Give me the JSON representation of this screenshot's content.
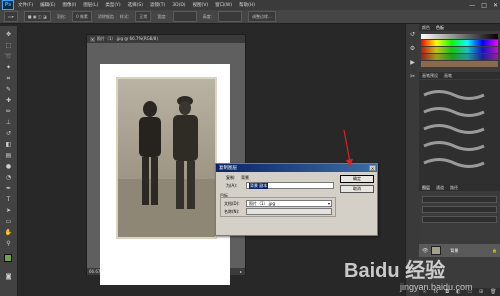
{
  "app": {
    "logo": "Ps",
    "accent": "#31a8ff"
  },
  "menu": [
    "文件(F)",
    "编辑(E)",
    "图像(I)",
    "图层(L)",
    "类型(Y)",
    "选择(S)",
    "滤镜(T)",
    "3D(D)",
    "视图(V)",
    "窗口(W)",
    "帮助(H)"
  ],
  "window_controls": [
    "—",
    "□",
    "✕"
  ],
  "options": {
    "feather_label": "羽化:",
    "feather_value": "0 像素",
    "antialias": "消除锯齿",
    "style_label": "样式:",
    "style_value": "正常",
    "width_label": "宽度:",
    "height_label": "高度:",
    "refine_edge": "调整边缘..."
  },
  "document": {
    "tab_title": "照片（1）.jpg @ 66.7%(RGB/8)",
    "zoom": "66.67%",
    "doc_size": "文档:1.32M/1.32M"
  },
  "dialog": {
    "title": "复制图层",
    "copy_label": "复制:",
    "copy_value": "背景",
    "as_label": "为(A):",
    "as_value": "背景 副本",
    "target_label": "目标",
    "doc_label": "文档(D):",
    "doc_value": "照片（1）.jpg",
    "name_label": "名称(N):",
    "name_value": "",
    "ok": "确定",
    "cancel": "取消",
    "highlight": "#0a246a"
  },
  "panels": {
    "swatch_tabs": [
      "颜色",
      "色板"
    ],
    "brush_tabs": [
      "画笔预设",
      "画笔"
    ],
    "layer_tabs": [
      "图层",
      "通道",
      "路径"
    ],
    "layer_name": "背景"
  },
  "watermark": {
    "logo": "Baidu 经验",
    "url": "jingyan.baidu.com"
  }
}
